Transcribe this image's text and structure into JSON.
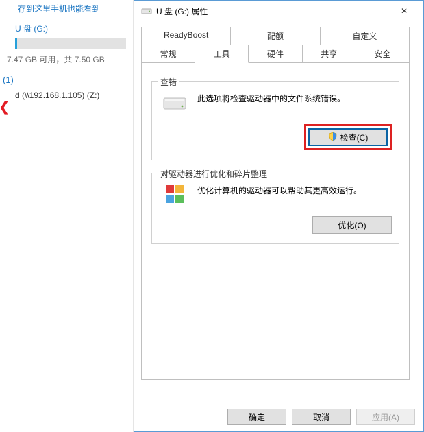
{
  "left": {
    "caption": "存到这里手机也能看到",
    "usb": {
      "name": "U 盘 (G:)",
      "size": "7.47 GB 可用，共 7.50 GB",
      "used_pct": 2
    },
    "group_marker": "(1)",
    "net_drive": "d (\\\\192.168.1.105) (Z:)"
  },
  "dlg": {
    "title": "U 盘 (G:) 属性",
    "close_glyph": "✕",
    "tabs_row1": [
      "ReadyBoost",
      "配额",
      "自定义"
    ],
    "tabs_row2": [
      "常规",
      "工具",
      "硬件",
      "共享",
      "安全"
    ],
    "active_tab_index_row2": 1,
    "check": {
      "legend": "查错",
      "text": "此选项将检查驱动器中的文件系统错误。",
      "button": "检查(C)"
    },
    "defrag": {
      "legend": "对驱动器进行优化和碎片整理",
      "text": "优化计算机的驱动器可以帮助其更高效运行。",
      "button": "优化(O)"
    },
    "footer": {
      "ok": "确定",
      "cancel": "取消",
      "apply": "应用(A)"
    }
  }
}
